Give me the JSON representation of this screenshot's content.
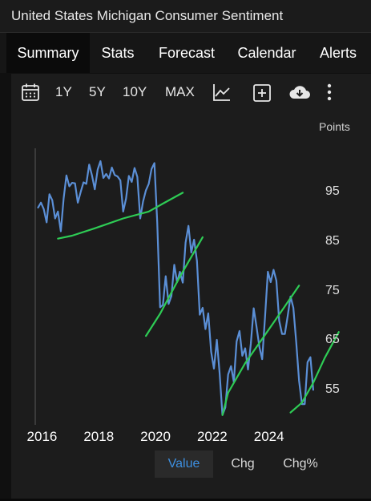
{
  "window": {
    "title": "United States Michigan Consumer Sentiment"
  },
  "tabs": [
    {
      "label": "Summary"
    },
    {
      "label": "Stats"
    },
    {
      "label": "Forecast"
    },
    {
      "label": "Calendar"
    },
    {
      "label": "Alerts"
    }
  ],
  "toolbar": {
    "ranges": [
      "1Y",
      "5Y",
      "10Y",
      "MAX"
    ],
    "icons": [
      "calendar-icon",
      "chart-type-icon",
      "add-indicator-icon",
      "download-cloud-icon",
      "more-vertical-icon"
    ]
  },
  "chart_data": {
    "type": "line",
    "unit_label": "Points",
    "yticks": [
      55,
      65,
      75,
      85,
      95
    ],
    "xticks": [
      "2016",
      "2018",
      "2020",
      "2022",
      "2024"
    ],
    "ylim": [
      48,
      104
    ],
    "xlim": [
      2015.9,
      2025.9
    ],
    "series": [
      {
        "color": "#5b8fd6",
        "x": [
          2016.0,
          2016.1,
          2016.2,
          2016.3,
          2016.4,
          2016.5,
          2016.6,
          2016.7,
          2016.8,
          2016.9,
          2017.0,
          2017.1,
          2017.2,
          2017.3,
          2017.4,
          2017.5,
          2017.6,
          2017.7,
          2017.8,
          2017.9,
          2018.0,
          2018.1,
          2018.2,
          2018.3,
          2018.4,
          2018.5,
          2018.6,
          2018.7,
          2018.8,
          2018.9,
          2019.0,
          2019.1,
          2019.2,
          2019.3,
          2019.4,
          2019.5,
          2019.6,
          2019.7,
          2019.8,
          2019.9,
          2020.0,
          2020.1,
          2020.2,
          2020.3,
          2020.4,
          2020.5,
          2020.6,
          2020.7,
          2020.8,
          2020.9,
          2021.0,
          2021.1,
          2021.2,
          2021.3,
          2021.4,
          2021.5,
          2021.6,
          2021.7,
          2021.8,
          2021.9,
          2022.0,
          2022.1,
          2022.2,
          2022.3,
          2022.4,
          2022.5,
          2022.6,
          2022.7,
          2022.8,
          2022.9,
          2023.0,
          2023.1,
          2023.2,
          2023.3,
          2023.4,
          2023.5,
          2023.6,
          2023.7,
          2023.8,
          2023.9,
          2024.0,
          2024.1,
          2024.2,
          2024.3,
          2024.4,
          2024.5,
          2024.6,
          2024.7,
          2024.8,
          2024.9,
          2025.0,
          2025.1,
          2025.2,
          2025.3,
          2025.4,
          2025.5,
          2025.6,
          2025.7
        ],
        "values": [
          92.0,
          93.0,
          91.7,
          89.0,
          94.7,
          93.5,
          89.8,
          91.2,
          87.2,
          93.8,
          98.5,
          96.3,
          97.0,
          96.9,
          93.0,
          95.1,
          97.1,
          96.8,
          100.7,
          98.5,
          95.7,
          99.7,
          101.4,
          98.0,
          98.8,
          97.9,
          100.1,
          98.6,
          98.3,
          97.5,
          91.2,
          93.8,
          98.4,
          97.2,
          100.0,
          98.2,
          89.8,
          93.2,
          95.5,
          96.8,
          99.8,
          101.0,
          89.1,
          71.8,
          72.3,
          78.1,
          72.5,
          74.1,
          80.4,
          76.9,
          79.0,
          76.8,
          84.9,
          88.3,
          82.9,
          85.5,
          81.2,
          70.3,
          71.7,
          67.4,
          70.6,
          62.8,
          59.4,
          65.2,
          58.4,
          50.0,
          51.5,
          58.2,
          59.9,
          56.7,
          64.9,
          67.0,
          62.0,
          63.5,
          59.2,
          64.4,
          71.6,
          67.9,
          63.8,
          61.3,
          69.7,
          79.0,
          76.9,
          79.4,
          77.2,
          69.1,
          66.4,
          66.4,
          70.1,
          74.0,
          71.7,
          64.7,
          57.0,
          52.2,
          52.2,
          60.7,
          61.7,
          55.1
        ]
      },
      {
        "color": "#2ecc55",
        "x": [
          2016.7,
          2017.2,
          2018.0,
          2019.0,
          2019.9,
          2020.4,
          2021.1
        ],
        "values": [
          85.7,
          86.3,
          87.8,
          89.8,
          91.2,
          92.8,
          95.0
        ]
      },
      {
        "color": "#2ecc55",
        "x": [
          2019.8,
          2020.3,
          2021.0,
          2021.8
        ],
        "values": [
          66.0,
          70.5,
          78.0,
          86.0
        ]
      },
      {
        "color": "#2ecc55",
        "x": [
          2022.5,
          2022.7,
          2023.3,
          2024.0,
          2024.7,
          2025.2
        ],
        "values": [
          50.0,
          54.5,
          60.5,
          66.2,
          72.0,
          76.2
        ]
      },
      {
        "color": "#2ecc55",
        "x": [
          2024.9,
          2025.3,
          2025.7,
          2026.1,
          2026.6
        ],
        "values": [
          50.5,
          52.5,
          56.5,
          61.5,
          66.8
        ]
      }
    ]
  },
  "segments": [
    {
      "label": "Value",
      "active": true
    },
    {
      "label": "Chg",
      "active": false
    },
    {
      "label": "Chg%",
      "active": false
    }
  ]
}
